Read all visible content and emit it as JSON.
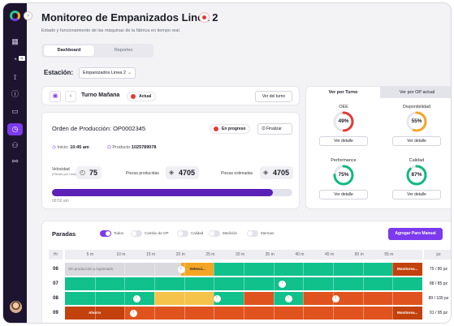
{
  "header": {
    "title": "Monitoreo de Empanizados Linea 2",
    "subtitle": "Estado y funcionamiento de las máquinas de la fábrica en tiempo real."
  },
  "sidebar": {
    "items": [
      {
        "icon": "dashboard-icon"
      },
      {
        "icon": "notifications-icon",
        "badge": "N"
      },
      {
        "icon": "rocket-icon"
      },
      {
        "icon": "alert-icon"
      },
      {
        "icon": "window-icon"
      },
      {
        "icon": "gauge-icon",
        "active": true
      },
      {
        "icon": "users-icon"
      },
      {
        "icon": "connections-icon"
      }
    ]
  },
  "tabs": [
    {
      "label": "Dashboard",
      "active": true
    },
    {
      "label": "Reportes",
      "active": false
    }
  ],
  "station": {
    "label": "Estación:",
    "value": "Empanizados Linea 2"
  },
  "shift": {
    "name": "Turno Mañana",
    "status": "Actual",
    "view_button": "Ver del turno"
  },
  "order": {
    "label": "Orden de Producción:",
    "number": "OP0002345",
    "status": "En progreso",
    "finish_button": "Finalizar",
    "start_label": "Inicio:",
    "start_time": "10:45 am",
    "product_label": "Producto",
    "product_code": "1025789078",
    "speed_label": "Velocidad",
    "speed_unit": "(Piezas por hora)",
    "speed_value": "75",
    "produced_label": "Piezas producidas",
    "produced_value": "4705",
    "estimated_label": "Piezas estimadas",
    "estimated_value": "4705",
    "progress": 0.92,
    "progress_time": "09:50 am"
  },
  "indicators": {
    "tabs": [
      {
        "label": "Ver por Turno",
        "active": true
      },
      {
        "label": "Ver por OP actual",
        "active": false
      }
    ],
    "detail_label": "Ver detalle",
    "gauges": [
      {
        "title": "OEE",
        "value": "49%",
        "pct": 0.49,
        "color": "#e53935"
      },
      {
        "title": "Disponibilidad",
        "value": "55%",
        "pct": 0.55,
        "color": "#f5a524"
      },
      {
        "title": "Performance",
        "value": "75%",
        "pct": 0.75,
        "color": "#10b981"
      },
      {
        "title": "Calidad",
        "value": "87%",
        "pct": 0.87,
        "color": "#10b981"
      }
    ]
  },
  "paradas": {
    "title": "Paradas",
    "toggles": [
      {
        "label": "Todos",
        "on": true
      },
      {
        "label": "Cambio de OP",
        "on": false
      },
      {
        "label": "Calidad",
        "on": false
      },
      {
        "label": "Medición",
        "on": false
      },
      {
        "label": "Mermas",
        "on": false
      }
    ],
    "add_button": "Agregar Paro Manual",
    "hour_header": "Hr",
    "pz_header": "pz",
    "minutes": [
      "5 m",
      "10 m",
      "15 m",
      "20 m",
      "25 m",
      "30 m",
      "35 m",
      "40 m",
      "45 m",
      "50 m",
      "55 m"
    ],
    "rows": [
      {
        "hour": "06",
        "pz": "75 / 80 pz",
        "segments": [
          {
            "from": 0,
            "to": 19.5,
            "color": "#d9d9de",
            "label": "Sin producción programado"
          },
          {
            "from": 19.5,
            "to": 25,
            "color": "#f5a524",
            "label": "Selecci..."
          },
          {
            "from": 25,
            "to": 55,
            "color": "#10c18c",
            "label": ""
          },
          {
            "from": 55,
            "to": 60,
            "color": "#c2410c",
            "label": "Monitorea..."
          }
        ]
      },
      {
        "hour": "07",
        "pz": "88 / 85 pz",
        "segments": [
          {
            "from": 0,
            "to": 60,
            "color": "#10c18c",
            "label": ""
          }
        ]
      },
      {
        "hour": "08",
        "pz": "89 / 100 pz",
        "segments": [
          {
            "from": 0,
            "to": 15,
            "color": "#10c18c",
            "label": ""
          },
          {
            "from": 15,
            "to": 25,
            "color": "#f5c24a",
            "label": ""
          },
          {
            "from": 25,
            "to": 30,
            "color": "#10c18c",
            "label": ""
          },
          {
            "from": 30,
            "to": 35,
            "color": "#e0531e",
            "label": ""
          },
          {
            "from": 35,
            "to": 40,
            "color": "#10c18c",
            "label": ""
          },
          {
            "from": 40,
            "to": 60,
            "color": "#e0531e",
            "label": ""
          }
        ]
      },
      {
        "hour": "09",
        "pz": "91 / 95 pz",
        "segments": [
          {
            "from": 0,
            "to": 10,
            "color": "#c2410c",
            "label": "Ahorro"
          },
          {
            "from": 10,
            "to": 55,
            "color": "#e0531e",
            "label": ""
          },
          {
            "from": 55,
            "to": 60,
            "color": "#c2410c",
            "label": "Monitorea..."
          }
        ]
      }
    ]
  }
}
